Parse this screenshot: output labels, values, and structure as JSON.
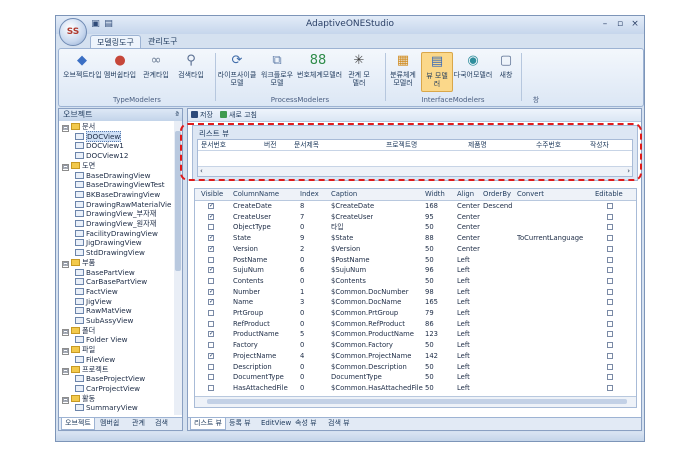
{
  "window": {
    "title": "AdaptiveONEStudio",
    "app_logo": "SS",
    "qat": [
      "▣",
      "▤"
    ],
    "controls": [
      "–",
      "▫",
      "×"
    ]
  },
  "ribbon_tabs": [
    "모델링도구",
    "관리도구"
  ],
  "ribbon": {
    "buttons": [
      {
        "label1": "오브젝트타입",
        "label2": "",
        "icon": "objects-icon",
        "glyph": "◆",
        "color": "#3b6fc4"
      },
      {
        "label1": "멤버쉽타입",
        "label2": "",
        "icon": "members-icon",
        "glyph": "●",
        "color": "#c6473a"
      },
      {
        "label1": "관계타입",
        "label2": "",
        "icon": "relation-icon",
        "glyph": "∞",
        "color": "#6b7c94"
      },
      {
        "label1": "검색타입",
        "label2": "",
        "icon": "search-icon",
        "glyph": "⚲",
        "color": "#5a6f92"
      },
      {
        "label1": "라이프사이클",
        "label2": "모델",
        "icon": "lifecycle-icon",
        "glyph": "⟳",
        "color": "#3d6aa8"
      },
      {
        "label1": "워크플로우",
        "label2": "모델",
        "icon": "workflow-icon",
        "glyph": "⧉",
        "color": "#5f7ca8"
      },
      {
        "label1": "번호체계모델러",
        "label2": "",
        "icon": "numbering-icon",
        "glyph": "88",
        "color": "#2f8c4a"
      },
      {
        "label1": "관계 모",
        "label2": "델러",
        "icon": "network-icon",
        "glyph": "✳",
        "color": "#444"
      },
      {
        "label1": "분류체계",
        "label2": "모델러",
        "icon": "classify-icon",
        "glyph": "▦",
        "color": "#d08a1c"
      },
      {
        "label1": "뷰 모델",
        "label2": "러",
        "icon": "view-icon",
        "glyph": "▤",
        "color": "#3a6bb8"
      },
      {
        "label1": "다국어모델러",
        "label2": "",
        "icon": "globe-icon",
        "glyph": "◉",
        "color": "#2f8e9c"
      },
      {
        "label1": "새창",
        "label2": "",
        "icon": "new-window-icon",
        "glyph": "▢",
        "color": "#5a6f92"
      }
    ],
    "groups": [
      "TypeModelers",
      "ProcessModelers",
      "InterfaceModelers",
      "창"
    ]
  },
  "left_panel": {
    "title": "오브젝트",
    "pin": "ª",
    "tree": [
      {
        "label": "문서",
        "level": 0,
        "kind": "folder",
        "exp": "⊟"
      },
      {
        "label": "DOCView",
        "level": 1,
        "kind": "view",
        "selected": true
      },
      {
        "label": "DOCView1",
        "level": 1,
        "kind": "view"
      },
      {
        "label": "DOCView12",
        "level": 1,
        "kind": "view"
      },
      {
        "label": "도면",
        "level": 0,
        "kind": "folder",
        "exp": "⊟"
      },
      {
        "label": "BaseDrawingView",
        "level": 1,
        "kind": "view"
      },
      {
        "label": "BaseDrawingViewTest",
        "level": 1,
        "kind": "view"
      },
      {
        "label": "BKBaseDrawingView",
        "level": 1,
        "kind": "view"
      },
      {
        "label": "DrawingRawMaterialVie",
        "level": 1,
        "kind": "view"
      },
      {
        "label": "DrawingView_부자재",
        "level": 1,
        "kind": "view"
      },
      {
        "label": "DrawingView_원자재",
        "level": 1,
        "kind": "view"
      },
      {
        "label": "FacilityDrawingView",
        "level": 1,
        "kind": "view"
      },
      {
        "label": "JigDrawingView",
        "level": 1,
        "kind": "view"
      },
      {
        "label": "StdDrawingView",
        "level": 1,
        "kind": "view"
      },
      {
        "label": "부품",
        "level": 0,
        "kind": "folder",
        "exp": "⊟"
      },
      {
        "label": "BasePartView",
        "level": 1,
        "kind": "view"
      },
      {
        "label": "CarBasePartView",
        "level": 1,
        "kind": "view"
      },
      {
        "label": "FactView",
        "level": 1,
        "kind": "view"
      },
      {
        "label": "JigView",
        "level": 1,
        "kind": "view"
      },
      {
        "label": "RawMatView",
        "level": 1,
        "kind": "view"
      },
      {
        "label": "SubAssyView",
        "level": 1,
        "kind": "view"
      },
      {
        "label": "폴더",
        "level": 0,
        "kind": "folder",
        "exp": "⊟"
      },
      {
        "label": "Folder View",
        "level": 1,
        "kind": "view"
      },
      {
        "label": "파일",
        "level": 0,
        "kind": "folder",
        "exp": "⊟"
      },
      {
        "label": "FileView",
        "level": 1,
        "kind": "view"
      },
      {
        "label": "프로젝트",
        "level": 0,
        "kind": "folder",
        "exp": "⊟"
      },
      {
        "label": "BaseProjectView",
        "level": 1,
        "kind": "view"
      },
      {
        "label": "CarProjectView",
        "level": 1,
        "kind": "view"
      },
      {
        "label": "활동",
        "level": 0,
        "kind": "folder",
        "exp": "⊟"
      },
      {
        "label": "SummaryView",
        "level": 1,
        "kind": "view"
      }
    ],
    "tabs": [
      "오브젝트",
      "멤버쉽",
      "관계",
      "검색"
    ]
  },
  "toolbar": {
    "save": "저장",
    "refresh": "새로 고침"
  },
  "list_view": {
    "title": "리스트 뷰",
    "columns": [
      "문서번호",
      "버전",
      "문서제목",
      "프로젝트명",
      "제품명",
      "수주번호",
      "작성자"
    ]
  },
  "grid": {
    "headers": [
      "Visible",
      "ColumnName",
      "Index",
      "Caption",
      "Width",
      "Align",
      "OrderBy",
      "Convert",
      "Editable"
    ],
    "rows": [
      {
        "visible": true,
        "name": "CreateDate",
        "index": "8",
        "caption": "$CreateDate",
        "width": "168",
        "align": "Center",
        "orderby": "Descend",
        "convert": "",
        "editable": false
      },
      {
        "visible": true,
        "name": "CreateUser",
        "index": "7",
        "caption": "$CreateUser",
        "width": "95",
        "align": "Center",
        "orderby": "",
        "convert": "",
        "editable": false
      },
      {
        "visible": false,
        "name": "ObjectType",
        "index": "0",
        "caption": "타입",
        "width": "50",
        "align": "Center",
        "orderby": "",
        "convert": "",
        "editable": false
      },
      {
        "visible": true,
        "name": "State",
        "index": "9",
        "caption": "$State",
        "width": "88",
        "align": "Center",
        "orderby": "",
        "convert": "ToCurrentLanguage",
        "editable": false
      },
      {
        "visible": true,
        "name": "Version",
        "index": "2",
        "caption": "$Version",
        "width": "50",
        "align": "Center",
        "orderby": "",
        "convert": "",
        "editable": false
      },
      {
        "visible": false,
        "name": "PostName",
        "index": "0",
        "caption": "$PostName",
        "width": "50",
        "align": "Left",
        "orderby": "",
        "convert": "",
        "editable": false
      },
      {
        "visible": true,
        "name": "SujuNum",
        "index": "6",
        "caption": "$SujuNum",
        "width": "96",
        "align": "Left",
        "orderby": "",
        "convert": "",
        "editable": false
      },
      {
        "visible": false,
        "name": "Contents",
        "index": "0",
        "caption": "$Contents",
        "width": "50",
        "align": "Left",
        "orderby": "",
        "convert": "",
        "editable": false
      },
      {
        "visible": true,
        "name": "Number",
        "index": "1",
        "caption": "$Common.DocNumber",
        "width": "98",
        "align": "Left",
        "orderby": "",
        "convert": "",
        "editable": false
      },
      {
        "visible": true,
        "name": "Name",
        "index": "3",
        "caption": "$Common.DocName",
        "width": "165",
        "align": "Left",
        "orderby": "",
        "convert": "",
        "editable": false
      },
      {
        "visible": false,
        "name": "PrtGroup",
        "index": "0",
        "caption": "$Common.PrtGroup",
        "width": "79",
        "align": "Left",
        "orderby": "",
        "convert": "",
        "editable": false
      },
      {
        "visible": false,
        "name": "RefProduct",
        "index": "0",
        "caption": "$Common.RefProduct",
        "width": "86",
        "align": "Left",
        "orderby": "",
        "convert": "",
        "editable": false
      },
      {
        "visible": true,
        "name": "ProductName",
        "index": "5",
        "caption": "$Common.ProductName",
        "width": "123",
        "align": "Left",
        "orderby": "",
        "convert": "",
        "editable": false
      },
      {
        "visible": false,
        "name": "Factory",
        "index": "0",
        "caption": "$Common.Factory",
        "width": "50",
        "align": "Left",
        "orderby": "",
        "convert": "",
        "editable": false
      },
      {
        "visible": true,
        "name": "ProjectName",
        "index": "4",
        "caption": "$Common.ProjectName",
        "width": "142",
        "align": "Left",
        "orderby": "",
        "convert": "",
        "editable": false
      },
      {
        "visible": false,
        "name": "Description",
        "index": "0",
        "caption": "$Common.Description",
        "width": "50",
        "align": "Left",
        "orderby": "",
        "convert": "",
        "editable": false
      },
      {
        "visible": false,
        "name": "DocumentType",
        "index": "0",
        "caption": "DocumentType",
        "width": "50",
        "align": "Left",
        "orderby": "",
        "convert": "",
        "editable": false
      },
      {
        "visible": false,
        "name": "HasAttachedFile",
        "index": "0",
        "caption": "$Common.HasAttachedFile",
        "width": "50",
        "align": "Left",
        "orderby": "",
        "convert": "",
        "editable": false
      }
    ]
  },
  "bottom_tabs": [
    "리스트 뷰",
    "등록 뷰",
    "EditView",
    "속성 뷰",
    "검색 뷰"
  ],
  "colors": {
    "highlight": "#e01b1b",
    "selected_tab": "#fbd88a"
  }
}
